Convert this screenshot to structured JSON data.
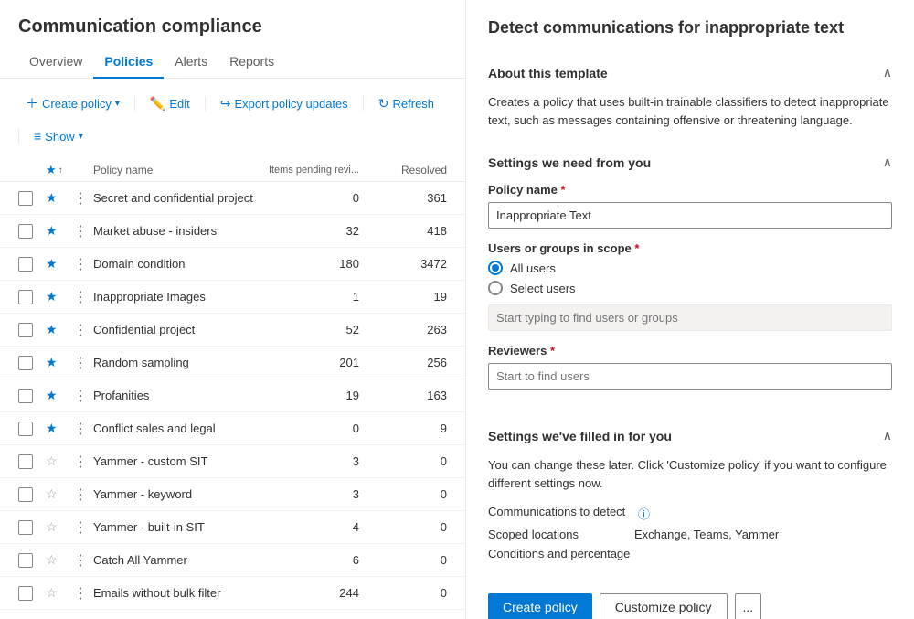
{
  "app": {
    "title": "Communication compliance"
  },
  "nav": {
    "tabs": [
      {
        "id": "overview",
        "label": "Overview",
        "active": false
      },
      {
        "id": "policies",
        "label": "Policies",
        "active": true
      },
      {
        "id": "alerts",
        "label": "Alerts",
        "active": false
      },
      {
        "id": "reports",
        "label": "Reports",
        "active": false
      }
    ]
  },
  "toolbar": {
    "create_label": "Create policy",
    "edit_label": "Edit",
    "export_label": "Export policy updates",
    "refresh_label": "Refresh",
    "show_label": "Show"
  },
  "table": {
    "headers": {
      "policy_name": "Policy name",
      "items_pending": "Items pending revi...",
      "resolved": "Resolved"
    },
    "rows": [
      {
        "name": "Secret and confidential project",
        "starred": true,
        "pending": 0,
        "resolved": 361
      },
      {
        "name": "Market abuse - insiders",
        "starred": true,
        "pending": 32,
        "resolved": 418
      },
      {
        "name": "Domain condition",
        "starred": true,
        "pending": 180,
        "resolved": 3472
      },
      {
        "name": "Inappropriate Images",
        "starred": true,
        "pending": 1,
        "resolved": 19
      },
      {
        "name": "Confidential project",
        "starred": true,
        "pending": 52,
        "resolved": 263
      },
      {
        "name": "Random sampling",
        "starred": true,
        "pending": 201,
        "resolved": 256
      },
      {
        "name": "Profanities",
        "starred": true,
        "pending": 19,
        "resolved": 163
      },
      {
        "name": "Conflict sales and legal",
        "starred": true,
        "pending": 0,
        "resolved": 9
      },
      {
        "name": "Yammer - custom SIT",
        "starred": false,
        "pending": 3,
        "resolved": 0
      },
      {
        "name": "Yammer - keyword",
        "starred": false,
        "pending": 3,
        "resolved": 0
      },
      {
        "name": "Yammer - built-in SIT",
        "starred": false,
        "pending": 4,
        "resolved": 0
      },
      {
        "name": "Catch All Yammer",
        "starred": false,
        "pending": 6,
        "resolved": 0
      },
      {
        "name": "Emails without bulk filter",
        "starred": false,
        "pending": 244,
        "resolved": 0
      }
    ]
  },
  "right_panel": {
    "title": "Detect communications for inappropriate text",
    "about_section": {
      "header": "About this template",
      "description": "Creates a policy that uses built-in trainable classifiers to detect inappropriate text, such as messages containing offensive or threatening language."
    },
    "settings_section": {
      "header": "Settings we need from you",
      "policy_name_label": "Policy name",
      "policy_name_value": "Inappropriate Text",
      "scope_label": "Users or groups in scope",
      "scope_options": [
        {
          "id": "all_users",
          "label": "All users",
          "checked": true
        },
        {
          "id": "select_users",
          "label": "Select users",
          "checked": false
        }
      ],
      "scope_placeholder": "Start typing to find users or groups",
      "reviewers_label": "Reviewers",
      "reviewers_placeholder": "Start to find users"
    },
    "filled_section": {
      "header": "Settings we've filled in for you",
      "description": "You can change these later. Click 'Customize policy' if you want to configure different settings now.",
      "comms_detect_label": "Communications to detect",
      "scoped_locations_label": "Scoped locations",
      "scoped_locations_value": "Exchange, Teams, Yammer",
      "conditions_label": "Conditions and percentage"
    },
    "buttons": {
      "create": "Create policy",
      "customize": "Customize policy",
      "more": "..."
    }
  }
}
